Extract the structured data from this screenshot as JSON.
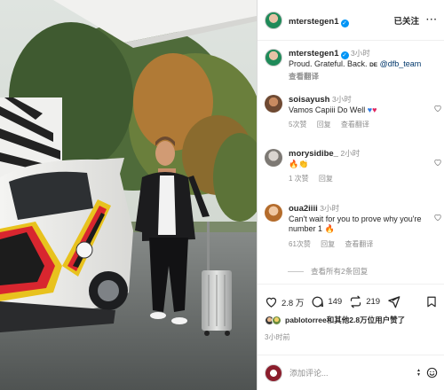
{
  "post": {
    "username": "mterstegen1",
    "follow_state": "已关注",
    "more_label": "···",
    "caption": {
      "username": "mterstegen1",
      "time": "3小时",
      "text": "Proud. Grateful. Back.",
      "badge": "DE",
      "mention": "@dfb_team",
      "see_translation": "查看翻译"
    }
  },
  "comments": [
    {
      "username": "soisayush",
      "time": "3小时",
      "text": "Vamos Capiii Do Well",
      "emoji": [
        "heart-blue",
        "heart-red"
      ],
      "likes": "5次赞",
      "reply": "回复",
      "see_translation": "查看翻译"
    },
    {
      "username": "morysidibe_",
      "time": "2小时",
      "text": "",
      "emoji": [
        "fire",
        "clap"
      ],
      "likes": "1 次赞",
      "reply": "回复",
      "see_translation": ""
    },
    {
      "username": "oua2iiii",
      "time": "3小时",
      "text": "Can't wait for you to prove why you're number 1",
      "emoji": [
        "fire"
      ],
      "likes": "61次赞",
      "reply": "回复",
      "see_translation": "查看翻译"
    }
  ],
  "view_replies": "查看所有2条回复",
  "actions": {
    "likes": "2.8 万",
    "comments": "149",
    "reposts": "219"
  },
  "liked_by": {
    "text_name": "pablotorree",
    "text_rest": "和其他2.8万位用户赞了"
  },
  "post_time": "3小时前",
  "comment_box": {
    "placeholder": "添加评论..."
  },
  "colors": {
    "verified": "#0095f6",
    "link": "#00376b",
    "muted": "#8e8e8e"
  }
}
